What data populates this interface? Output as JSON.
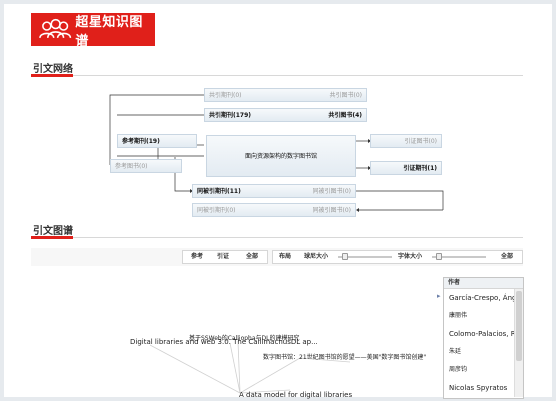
{
  "logo": {
    "text": "超星知识图谱"
  },
  "sections": {
    "network_title": "引文网络",
    "graph_title": "引文图谱"
  },
  "network": {
    "top_row": {
      "left": "共引期刊(0)",
      "right": "共引图书(0)"
    },
    "row2": {
      "left": "共引期刊(179)",
      "right": "共引图书(4)"
    },
    "ref_journals": "参考期刊(19)",
    "ref_books": "参考图书(0)",
    "center": "面向资源架构的数字图书馆",
    "cited_books_top": "引证图书(0)",
    "cited_journals": "引证期刊(1)",
    "cocited_row1": {
      "left": "同被引期刊(11)",
      "right": "同被引图书(0)"
    },
    "cocited_row2": {
      "left": "同被引期刊(0)",
      "right": "同被引图书(0)"
    }
  },
  "controls": {
    "ref": "参考",
    "cite": "引证",
    "all": "全部",
    "layout": "布局",
    "node_size": "球尼大小",
    "font_size": "字体大小",
    "all2": "全部"
  },
  "author_panel": {
    "header": "作者",
    "items": [
      "García-Crespo, Ángel",
      "康丽伟",
      "Colomo-Palacios, R",
      "朱廷",
      "周彦钧",
      "Nicolas Spyratos"
    ]
  },
  "graph_labels": {
    "a": "基于SSWeb的Calliopha与DL的建模研究",
    "b": "Digital libraries and web 3.0. The CallimachusDL ap...",
    "c": "数字图书馆：21世纪图书馆的愿望——美国\"数字图书馆创建\"",
    "d": "A data model for digital libraries"
  }
}
